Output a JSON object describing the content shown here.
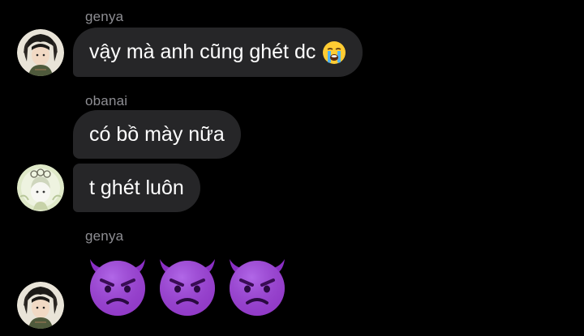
{
  "messages": [
    {
      "sender": "genya",
      "text": "vậy mà anh cũng ghét dc",
      "emoji": "loudly-crying-face"
    },
    {
      "sender": "obanai",
      "texts": [
        "có bồ mày nữa",
        "t ghét luôn"
      ]
    },
    {
      "sender": "genya",
      "emojis": [
        "angry-face-with-horns",
        "angry-face-with-horns",
        "angry-face-with-horns"
      ]
    }
  ],
  "colors": {
    "background": "#000000",
    "bubble": "#262628",
    "sender_name": "#8e8e93",
    "text": "#ffffff",
    "devil_purple": "#9a3fd0"
  }
}
